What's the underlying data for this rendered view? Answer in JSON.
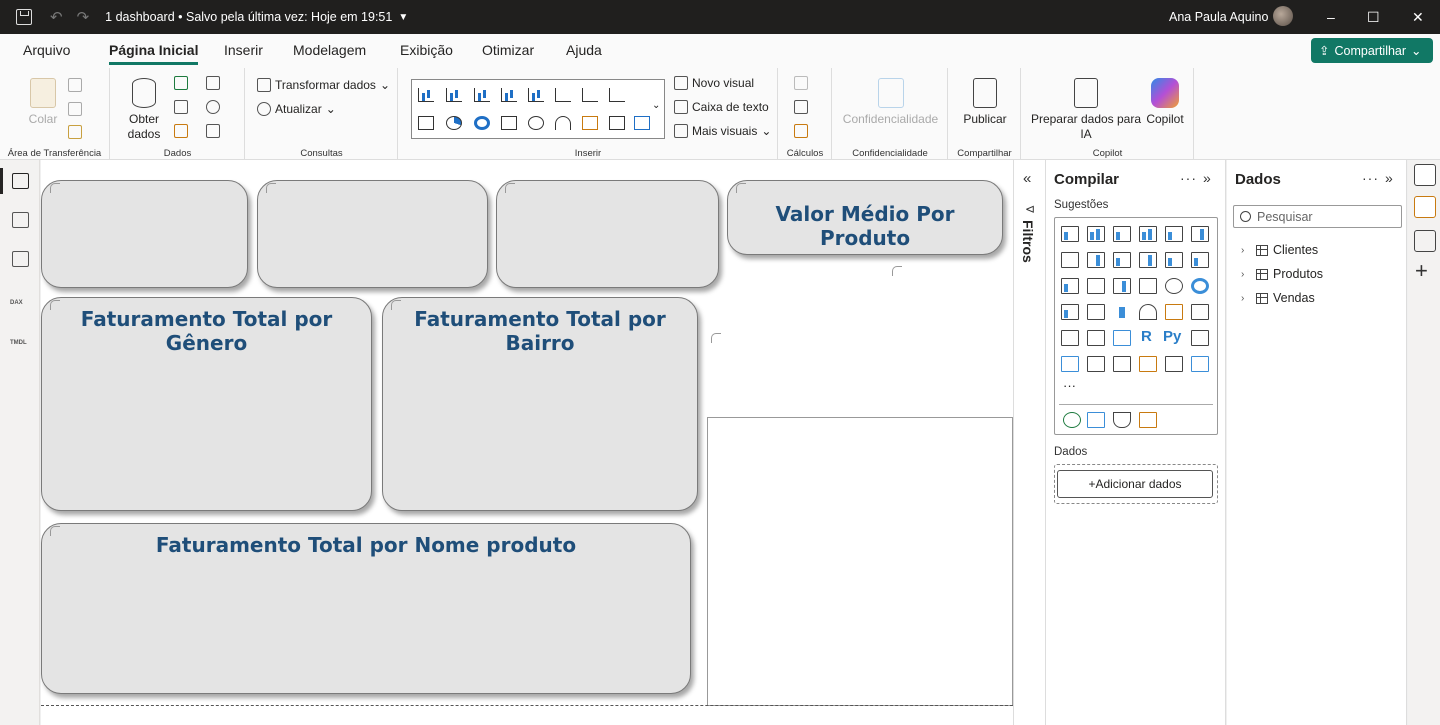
{
  "titlebar": {
    "document": "1 dashboard • Salvo pela última vez: Hoje em 19:51",
    "user": "Ana Paula Aquino",
    "minimize": "–",
    "maximize": "☐",
    "close": "✕"
  },
  "ribbon_tabs": [
    "Arquivo",
    "Página Inicial",
    "Inserir",
    "Modelagem",
    "Exibição",
    "Otimizar",
    "Ajuda"
  ],
  "active_tab": "Página Inicial",
  "share_button": "Compartilhar",
  "groups": {
    "clipboard": {
      "label": "Área de Transferência",
      "paste": "Colar"
    },
    "data": {
      "label": "Dados",
      "get_data": "Obter dados"
    },
    "queries": {
      "label": "Consultas",
      "transform": "Transformar dados",
      "refresh": "Atualizar"
    },
    "insert": {
      "label": "Inserir",
      "new_visual": "Novo visual",
      "text_box": "Caixa de texto",
      "more_visuals": "Mais visuais"
    },
    "calculations": {
      "label": "Cálculos"
    },
    "sensitivity": {
      "label": "Confidencialidade",
      "button": "Confidencialidade"
    },
    "share": {
      "label": "Compartilhar",
      "publish": "Publicar"
    },
    "copilot": {
      "label": "Copilot",
      "prepare": "Preparar dados para IA",
      "copilot": "Copilot"
    }
  },
  "leftbar": {
    "dax": "DAX",
    "tmdl": "TMDL"
  },
  "canvas": {
    "card_avg": "Valor Médio Por Produto",
    "card_gender": "Faturamento Total por Gênero",
    "card_district": "Faturamento Total por Bairro",
    "card_product": "Faturamento Total por Nome produto"
  },
  "filters": {
    "label": "Filtros"
  },
  "compilar": {
    "title": "Compilar",
    "suggestions": "Sugestões",
    "data_label": "Dados",
    "add_data": "+Adicionar dados",
    "more": "···"
  },
  "dados": {
    "title": "Dados",
    "search_placeholder": "Pesquisar",
    "tables": [
      "Clientes",
      "Produtos",
      "Vendas"
    ]
  },
  "colors": {
    "accent": "#117865",
    "title_blue": "#1f4e79",
    "card_bg": "#e4e4e4"
  }
}
